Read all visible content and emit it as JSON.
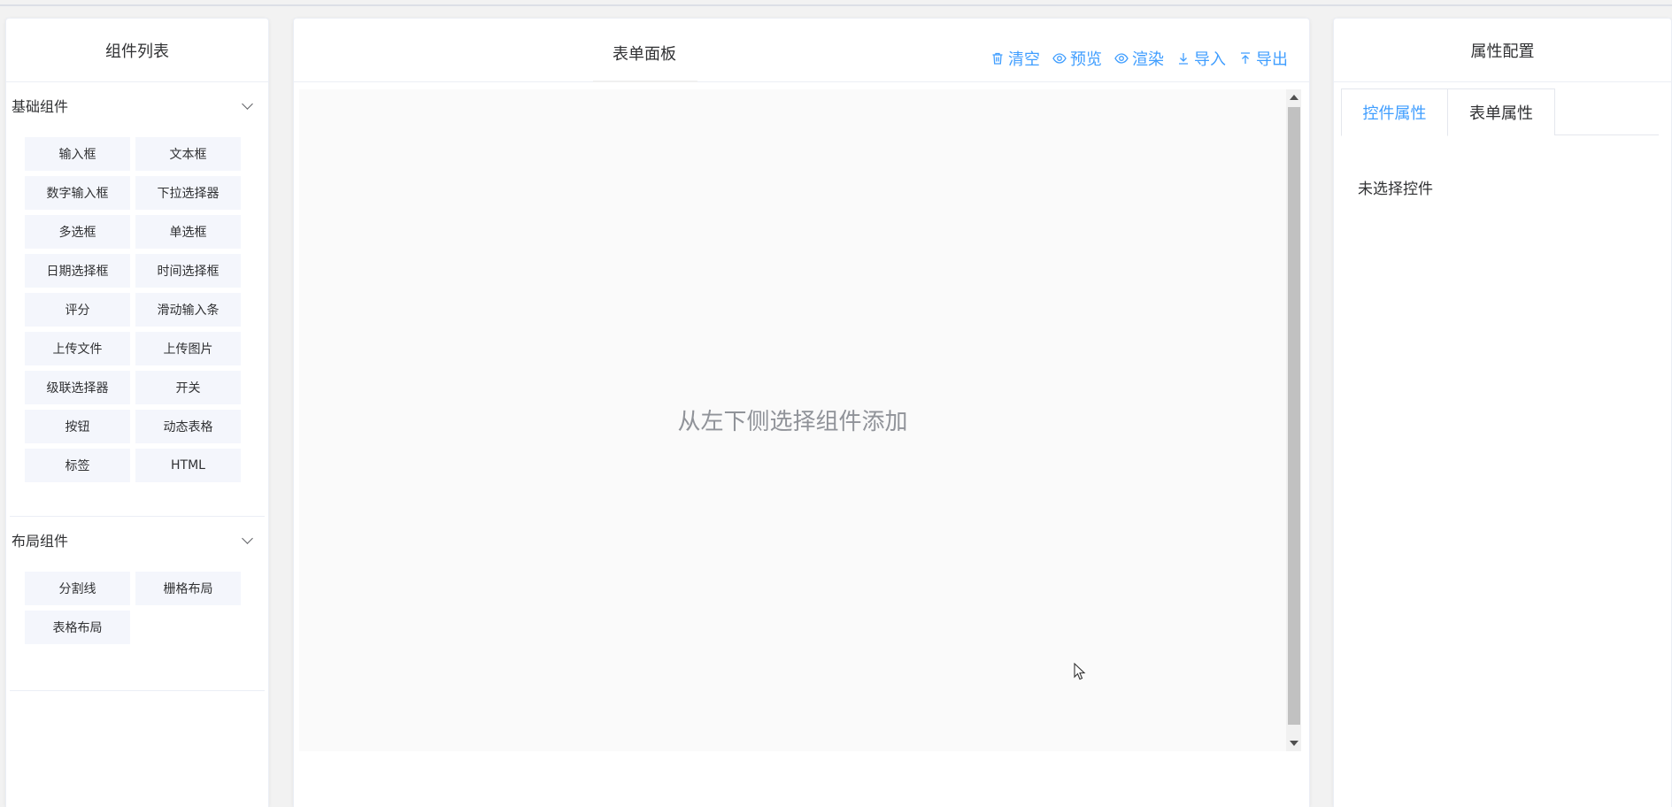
{
  "left_panel": {
    "title": "组件列表",
    "groups": [
      {
        "title": "基础组件",
        "items": [
          "输入框",
          "文本框",
          "数字输入框",
          "下拉选择器",
          "多选框",
          "单选框",
          "日期选择框",
          "时间选择框",
          "评分",
          "滑动输入条",
          "上传文件",
          "上传图片",
          "级联选择器",
          "开关",
          "按钮",
          "动态表格",
          "标签",
          "HTML"
        ]
      },
      {
        "title": "布局组件",
        "items": [
          "分割线",
          "栅格布局",
          "表格布局"
        ]
      }
    ]
  },
  "center_panel": {
    "title": "表单面板",
    "toolbar": {
      "clear": "清空",
      "preview": "预览",
      "render": "渲染",
      "import": "导入",
      "export": "导出"
    },
    "canvas_hint": "从左下侧选择组件添加"
  },
  "right_panel": {
    "title": "属性配置",
    "tabs": [
      "控件属性",
      "表单属性"
    ],
    "empty_message": "未选择控件"
  },
  "colors": {
    "accent": "#409eff",
    "component_bg": "#f4f6fc",
    "canvas_bg": "#fafafa"
  }
}
